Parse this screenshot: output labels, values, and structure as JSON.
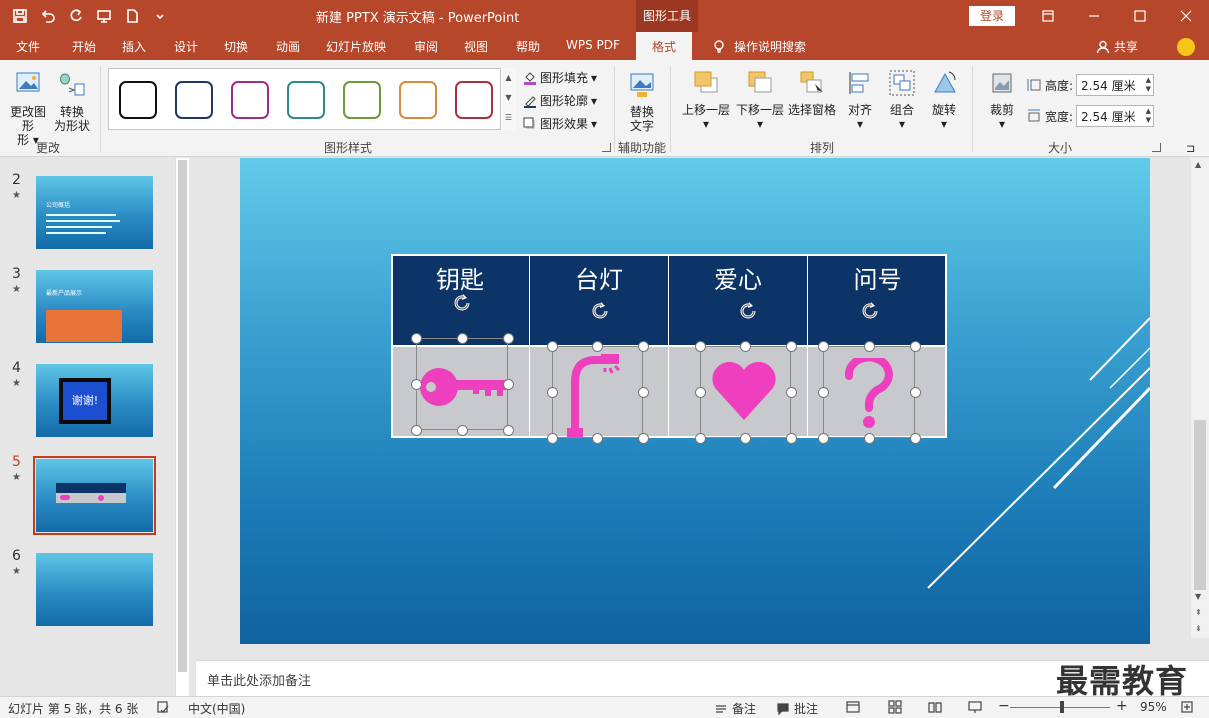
{
  "titlebar": {
    "doc_title": "新建 PPTX 演示文稿  -  PowerPoint",
    "context_tab": "图形工具",
    "login": "登录"
  },
  "tabs": [
    "文件",
    "开始",
    "插入",
    "设计",
    "切换",
    "动画",
    "幻灯片放映",
    "审阅",
    "视图",
    "帮助",
    "WPS PDF"
  ],
  "active_tab": "格式",
  "tellme": "操作说明搜索",
  "share": "共享",
  "ribbon": {
    "change_shape": "更改图形",
    "change_shape_sub": "形",
    "convert": "转换",
    "convert_sub": "为形状",
    "group_change": "更改",
    "style_colors": [
      "#111111",
      "#1f3864",
      "#9b2d8f",
      "#2e8b8b",
      "#6a9a3a",
      "#d98a3d",
      "#a8323e"
    ],
    "fill": "图形填充",
    "outline": "图形轮廓",
    "effect": "图形效果",
    "group_styles": "图形样式",
    "alt_text": "替换",
    "alt_text_sub": "文字",
    "group_access": "辅助功能",
    "bring_forward": "上移一层",
    "send_backward": "下移一层",
    "selection_pane": "选择窗格",
    "align": "对齐",
    "group_btn": "组合",
    "rotate": "旋转",
    "group_arrange": "排列",
    "crop": "裁剪",
    "height_label": "高度:",
    "height_value": "2.54 厘米",
    "width_label": "宽度:",
    "width_value": "2.54 厘米",
    "group_size": "大小"
  },
  "thumbnails": [
    {
      "num": "2",
      "title": "公司概括"
    },
    {
      "num": "3",
      "title": "最新产品展示"
    },
    {
      "num": "4",
      "title": "谢谢!"
    },
    {
      "num": "5",
      "title": ""
    },
    {
      "num": "6",
      "title": ""
    }
  ],
  "slide_table": {
    "headers": [
      "钥匙",
      "台灯",
      "爱心",
      "问号"
    ],
    "icon_color": "#ee3fbf",
    "header_color": "#0c3466"
  },
  "notes_placeholder": "单击此处添加备注",
  "watermark": "最需教育",
  "statusbar": {
    "slide_info": "幻灯片 第 5 张，共 6 张",
    "language": "中文(中国)",
    "notes": "备注",
    "comments": "批注",
    "zoom": "95%"
  }
}
